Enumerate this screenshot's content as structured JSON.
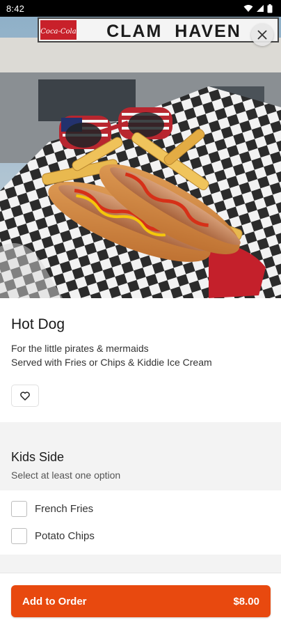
{
  "status_bar": {
    "time": "8:42",
    "icons": [
      "wifi-icon",
      "signal-icon",
      "battery-icon"
    ]
  },
  "hero": {
    "sign_text": "CLAM  HAVEN",
    "brand_text": "Coca-Cola"
  },
  "item": {
    "title": "Hot Dog",
    "description_line1": "For the little pirates & mermaids",
    "description_line2": "Served with Fries or Chips & Kiddie Ice Cream",
    "favorite_icon": "heart-icon"
  },
  "kids_side": {
    "title": "Kids Side",
    "subtitle": "Select at least one option",
    "options": [
      {
        "label": "French Fries",
        "checked": false
      },
      {
        "label": "Potato Chips",
        "checked": false
      }
    ]
  },
  "footer": {
    "add_label": "Add to Order",
    "price": "$8.00"
  },
  "colors": {
    "accent": "#e8490f",
    "section_bg": "#f3f3f3"
  }
}
